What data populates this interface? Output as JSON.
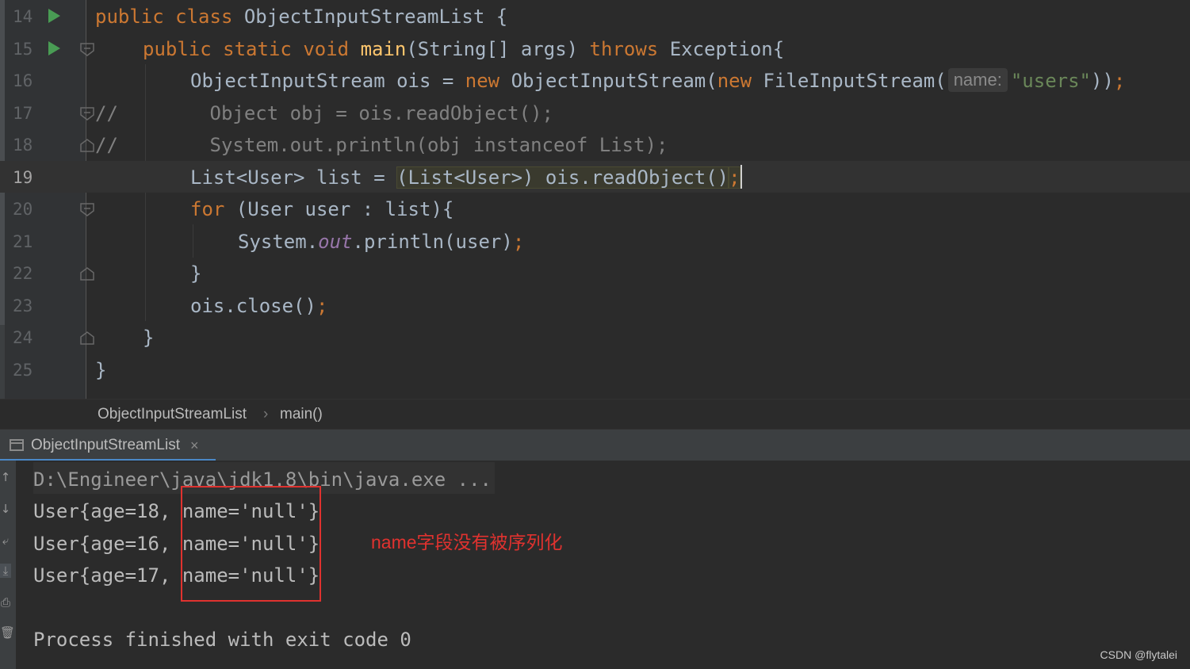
{
  "editor": {
    "lines": [
      {
        "number": "14",
        "run_icon": "run-icon"
      },
      {
        "number": "15",
        "run_icon": "run-icon",
        "fold_icon": "fold-open-icon"
      },
      {
        "number": "16",
        "hint": "name:"
      },
      {
        "number": "17",
        "fold_icon": "fold-open-icon"
      },
      {
        "number": "18",
        "fold_icon": "fold-close-icon"
      },
      {
        "number": "19",
        "current": true
      },
      {
        "number": "20",
        "fold_icon": "fold-open-icon"
      },
      {
        "number": "21"
      },
      {
        "number": "22",
        "fold_icon": "fold-close-icon"
      },
      {
        "number": "23"
      },
      {
        "number": "24",
        "fold_icon": "fold-close-icon"
      },
      {
        "number": "25"
      }
    ],
    "code": {
      "l14": {
        "public": "public",
        "class": "class",
        "name": "ObjectInputStreamList",
        "brace": " {"
      },
      "l15": {
        "public": "public",
        "static": "static",
        "void": "void",
        "main": "main",
        "params": "(String[] args) ",
        "throws": "throws",
        "exc": " Exception{"
      },
      "l16": {
        "decl": "ObjectInputStream ois = ",
        "new1": "new",
        "ctor1": " ObjectInputStream(",
        "new2": "new",
        "ctor2": " FileInputStream(",
        "hint": "name:",
        "str": "\"users\"",
        "close": "))",
        "semi": ";"
      },
      "l17": {
        "comment": "//        Object obj = ois.readObject();"
      },
      "l18": {
        "comment": "//        System.out.println(obj instanceof List);"
      },
      "l19": {
        "decl": "List<User> list = ",
        "cast": "(List<User>) ois.readObject()",
        "semi": ";"
      },
      "l20": {
        "for": "for",
        "rest": " (User user : list){"
      },
      "l21": {
        "system": "System.",
        "out": "out",
        "println": ".println(user)",
        "semi": ";"
      },
      "l22": {
        "brace": "}"
      },
      "l23": {
        "call": "ois.close()",
        "semi": ";"
      },
      "l24": {
        "brace": "}"
      },
      "l25": {
        "brace": "}"
      }
    }
  },
  "breadcrumb": {
    "items": [
      "ObjectInputStreamList",
      "main()"
    ],
    "separator": "›"
  },
  "run_panel": {
    "tab_label": "ObjectInputStreamList",
    "tab_close": "×",
    "tab_icon": "console-icon",
    "toolbar_icons": [
      "scroll-up-icon",
      "scroll-down-icon",
      "soft-wrap-icon",
      "scroll-to-end-icon",
      "print-icon",
      "trash-icon"
    ],
    "toolbar_glyphs": [
      "↑",
      "↓",
      "⤶",
      "⤓",
      "⎙",
      "🗑"
    ],
    "console": {
      "command": "D:\\Engineer\\java\\jdk1.8\\bin\\java.exe ...",
      "output": [
        "User{age=18, name='null'}",
        "User{age=16, name='null'}",
        "User{age=17, name='null'}"
      ],
      "finish": "Process finished with exit code 0"
    }
  },
  "annotation": {
    "text": "name字段没有被序列化",
    "color": "#e0322f"
  },
  "watermark": "CSDN @flytalei",
  "colors": {
    "background": "#2b2b2b",
    "keyword": "#cc7832",
    "method": "#ffc66d",
    "string": "#6a8759",
    "comment": "#808080",
    "field": "#9876aa",
    "run_green": "#499c54",
    "tab_accent": "#4a88c7"
  }
}
